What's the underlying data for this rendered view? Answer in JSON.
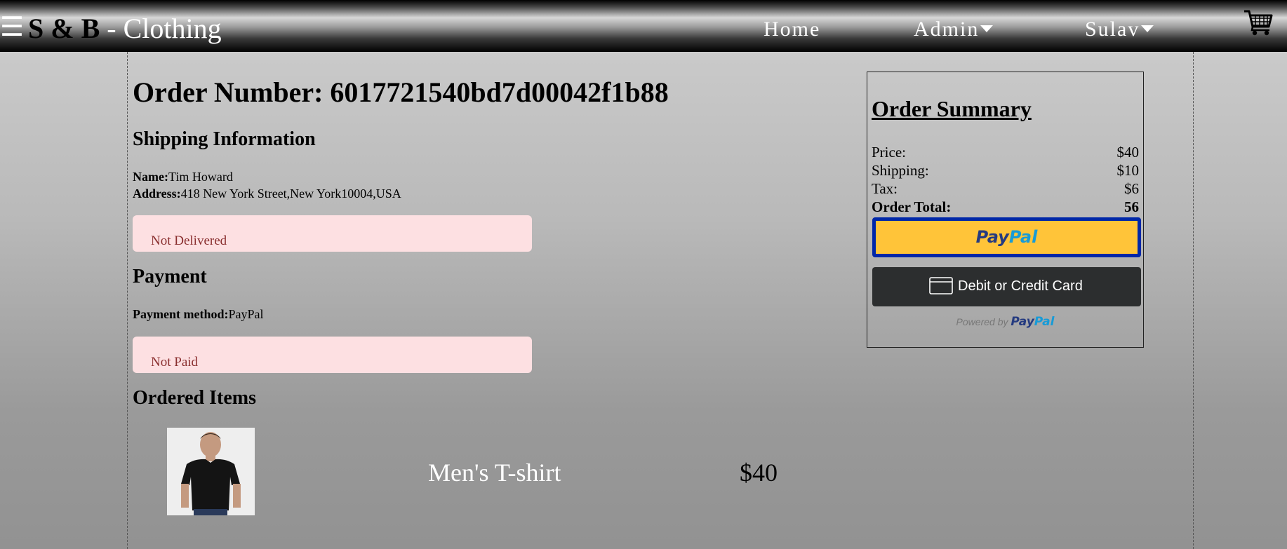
{
  "header": {
    "brand_bold": "S & B",
    "brand_rest": " - Clothing",
    "nav": {
      "home": "Home",
      "admin": "Admin",
      "user": "Sulav"
    }
  },
  "order": {
    "title": "Order Number: 6017721540bd7d00042f1b88",
    "shipping": {
      "heading": "Shipping Information",
      "name_label": "Name:",
      "name": "Tim Howard",
      "address_label": "Address:",
      "address": "418 New York Street,New York10004,USA",
      "status": "Not Delivered"
    },
    "payment": {
      "heading": "Payment",
      "method_label": "Payment method:",
      "method": "PayPal",
      "status": "Not Paid"
    },
    "items": {
      "heading": "Ordered Items",
      "list": [
        {
          "name": "Men's T-shirt",
          "price": "$40",
          "image": "man-in-black-tshirt"
        }
      ]
    }
  },
  "summary": {
    "title": "Order Summary",
    "rows": [
      {
        "label": "Price:",
        "value": "$40"
      },
      {
        "label": "Shipping:",
        "value": "$10"
      },
      {
        "label": "Tax:",
        "value": "$6"
      },
      {
        "label": "Order Total:",
        "value": "56"
      }
    ],
    "paypal_button": {
      "part1": "Pay",
      "part2": "Pal"
    },
    "card_button": "Debit or Credit Card",
    "powered_by": "Powered by",
    "powered_brand": {
      "part1": "Pay",
      "part2": "Pal"
    }
  },
  "colors": {
    "alert_bg": "#fde0e2",
    "alert_text": "#8a2f2f",
    "paypal_yellow": "#ffc439",
    "paypal_border": "#0027a8",
    "card_btn": "#2c2e2f"
  }
}
